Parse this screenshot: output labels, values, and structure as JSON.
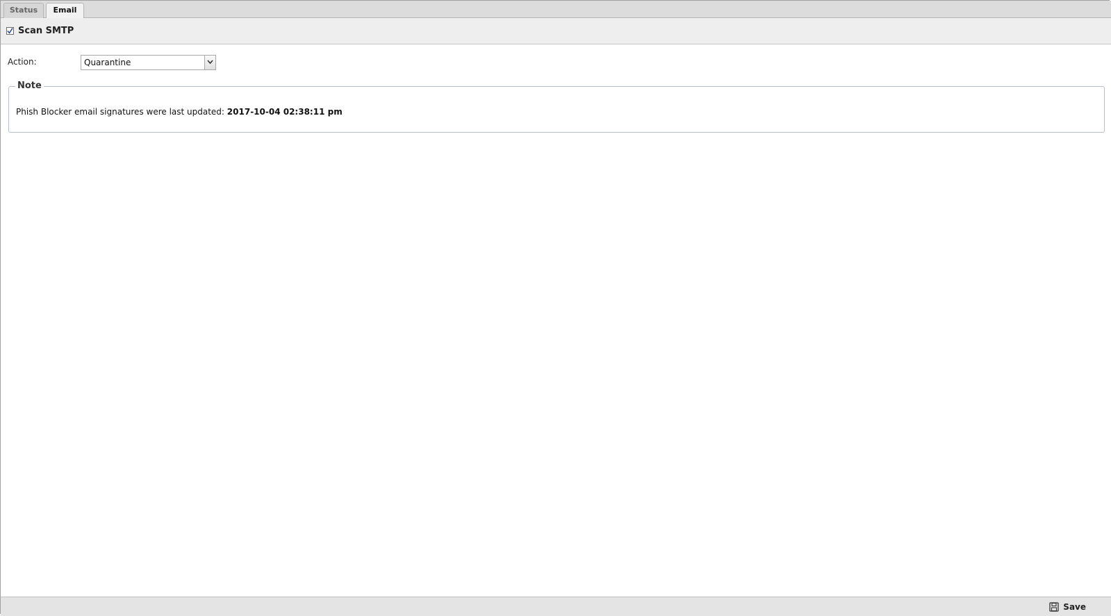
{
  "tabs": [
    {
      "label": "Status",
      "active": false
    },
    {
      "label": "Email",
      "active": true
    }
  ],
  "scan": {
    "label": "Scan SMTP",
    "checked": true
  },
  "action": {
    "label": "Action:",
    "selected": "Quarantine"
  },
  "note": {
    "legend": "Note",
    "text": "Phish Blocker email signatures were last updated: ",
    "timestamp": "2017-10-04 02:38:11 pm"
  },
  "footer": {
    "save_label": "Save",
    "save_icon": "floppy-disk-icon"
  },
  "colors": {
    "tabbar_bg": "#dcdcdc",
    "toolbar_bg": "#eeeeee",
    "fieldset_border": "#b8bcd0"
  }
}
